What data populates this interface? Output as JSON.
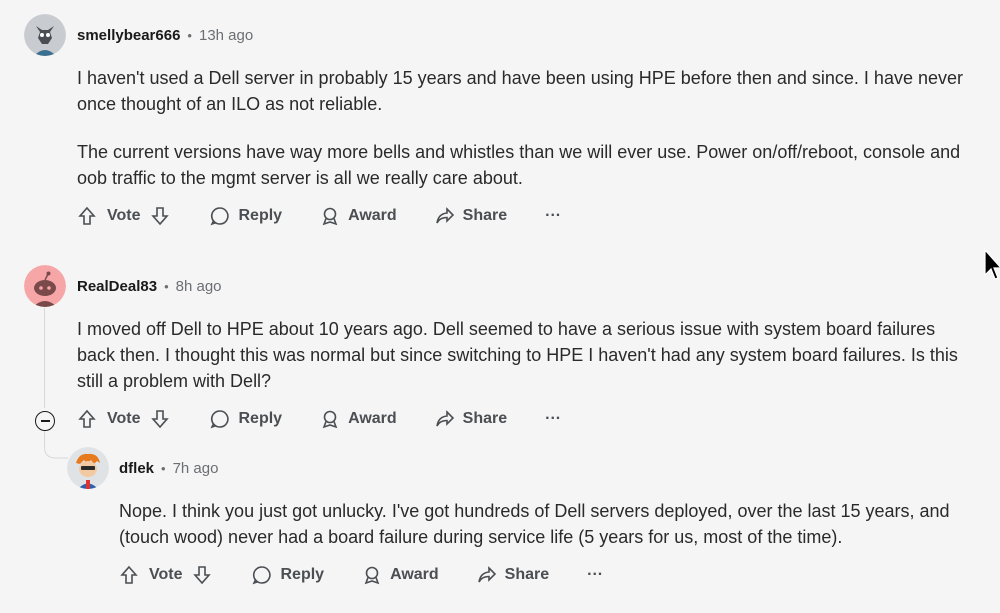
{
  "comments": [
    {
      "author": "smellybear666",
      "time": "13h ago",
      "paragraphs": [
        "I haven't used a Dell server in probably 15 years and have been using HPE before then and since. I have never once thought of an ILO as not reliable.",
        "The current versions have way more bells and whistles than we will ever use. Power on/off/reboot, console and oob traffic to the mgmt server is all we really care about."
      ]
    },
    {
      "author": "RealDeal83",
      "time": "8h ago",
      "paragraphs": [
        "I moved off Dell to HPE about 10 years ago. Dell seemed to have a serious issue with system board failures back then. I thought this was normal but since switching to HPE I haven't had any system board failures. Is this still a problem with Dell?"
      ]
    },
    {
      "author": "dflek",
      "time": "7h ago",
      "paragraphs": [
        "Nope. I think you just got unlucky. I've got hundreds of Dell servers deployed, over the last 15 years, and (touch wood) never had a board failure during service life (5 years for us, most of the time)."
      ]
    }
  ],
  "actions": {
    "vote": "Vote",
    "reply": "Reply",
    "award": "Award",
    "share": "Share",
    "more": "···"
  },
  "separator": "•",
  "colors": {
    "background": "#f5f5f5",
    "text": "#1a1a1b",
    "muted": "#6b6f73",
    "thread_line": "#d6d8da"
  }
}
